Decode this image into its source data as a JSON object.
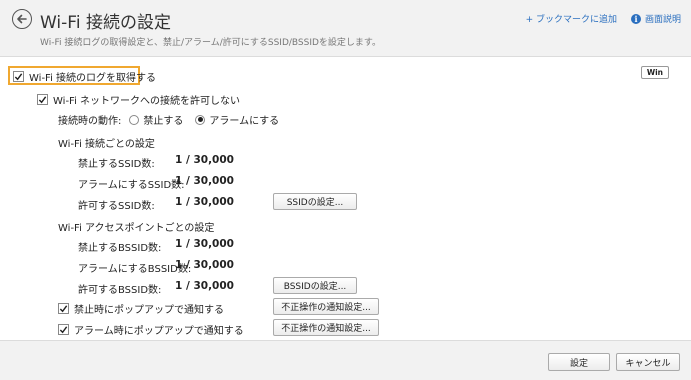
{
  "header": {
    "title": "Wi-Fi 接続の設定",
    "subtitle": "Wi-Fi 接続ログの取得設定と、禁止/アラーム/許可にするSSID/BSSIDを設定します。",
    "bookmark_label": "+ ブックマークに追加",
    "help_label": "画面説明"
  },
  "main": {
    "log_checkbox_label": "Wi-Fi 接続のログを取得する",
    "log_checked": true,
    "win_badge": "Win",
    "deny_checkbox_label": "Wi-Fi ネットワークへの接続を許可しない",
    "deny_checked": true,
    "action_label": "接続時の動作:",
    "radio_options": [
      "禁止する",
      "アラームにする"
    ],
    "radio_selected": "アラームにする",
    "ssid_section": {
      "title": "Wi-Fi 接続ごとの設定",
      "rows": [
        {
          "label": "禁止するSSID数:",
          "value": "1 / 30,000"
        },
        {
          "label": "アラームにするSSID数:",
          "value": "1 / 30,000"
        },
        {
          "label": "許可するSSID数:",
          "value": "1 / 30,000"
        }
      ],
      "button_label": "SSIDの設定..."
    },
    "bssid_section": {
      "title": "Wi-Fi アクセスポイントごとの設定",
      "rows": [
        {
          "label": "禁止するBSSID数:",
          "value": "1 / 30,000"
        },
        {
          "label": "アラームにするBSSID数:",
          "value": "1 / 30,000"
        },
        {
          "label": "許可するBSSID数:",
          "value": "1 / 30,000"
        }
      ],
      "button_label": "BSSIDの設定..."
    },
    "popup_deny_label": "禁止時にポップアップで通知する",
    "popup_deny_checked": true,
    "popup_alarm_label": "アラーム時にポップアップで通知する",
    "popup_alarm_checked": true,
    "notify_button_label": "不正操作の通知設定..."
  },
  "footer": {
    "ok_label": "設定",
    "cancel_label": "キャンセル"
  },
  "colors": {
    "accent_link": "#2a6fbf",
    "highlight": "#f0a830",
    "header_bg": "#f2f2f2"
  },
  "icons": [
    "back-arrow-icon",
    "info-icon",
    "checkmark-icon"
  ]
}
